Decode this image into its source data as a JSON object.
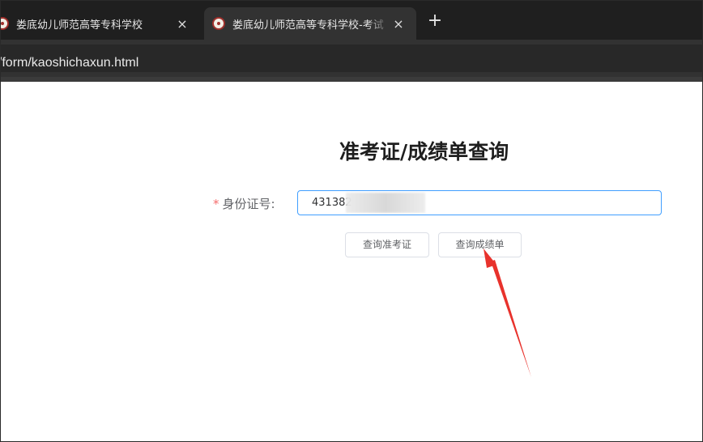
{
  "browser": {
    "tabs": [
      {
        "title": "娄底幼儿师范高等专科学校",
        "active": false,
        "close": "×"
      },
      {
        "title": "娄底幼儿师范高等专科学校-考试",
        "active": true,
        "close": "×"
      }
    ],
    "new_tab": "+",
    "url": "cn/form/kaoshichaxun.html"
  },
  "page": {
    "title": "准考证/成绩单查询",
    "form": {
      "required_mark": "*",
      "id_label": "身份证号:",
      "id_value": "431382"
    },
    "buttons": {
      "admit_card": "查询准考证",
      "score_report": "查询成绩单"
    }
  },
  "colors": {
    "annotation_arrow": "#e8322c",
    "input_focus_border": "#409eff",
    "required_star": "#f56c6c"
  }
}
